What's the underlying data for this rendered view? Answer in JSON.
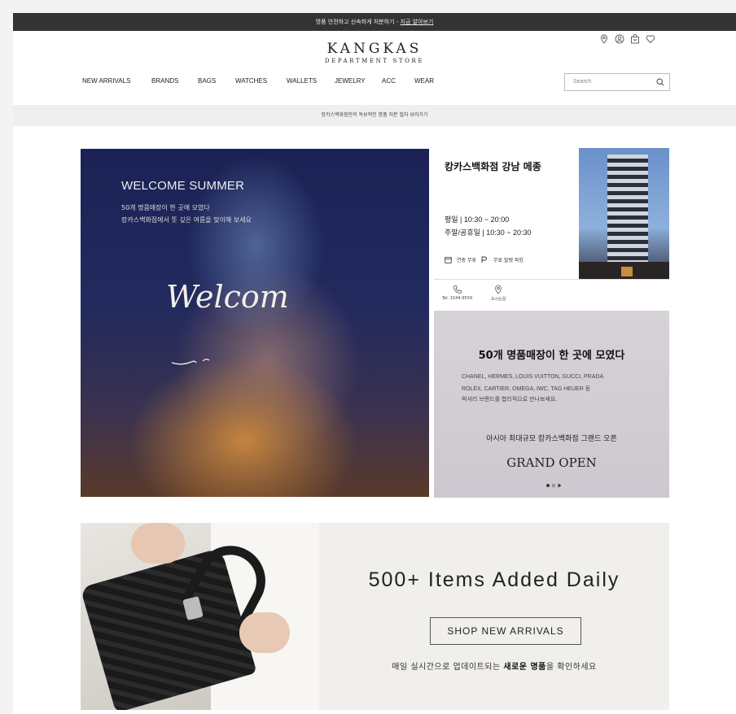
{
  "topbar": {
    "text": "명품 안전하고 신속하게 처분하기 - ",
    "link": "지금 알아보기"
  },
  "logo": {
    "name": "KANGKAS",
    "sub": "DEPARTMENT STORE"
  },
  "header_icons": [
    "location-icon",
    "user-icon",
    "shopping-bag-icon",
    "heart-icon"
  ],
  "nav": [
    "NEW ARRIVALS",
    "BRANDS",
    "BAGS",
    "WATCHES",
    "WALLETS",
    "JEWELRY",
    "ACC",
    "WEAR"
  ],
  "search": {
    "placeholder": "Search"
  },
  "subbar": {
    "text": "캉카스백화점만의 독보적인 명품 처분 절차 보러가기"
  },
  "hero": {
    "title": "WELCOME SUMMER",
    "line1": "50개 명품매장이 한 곳에 모였다",
    "line2": "캉카스백화점에서 뜻 깊은 여름을 맞이해 보세요",
    "script": "Welcom"
  },
  "store": {
    "title": "캉카스백화점 강남 메종",
    "weekday": "평일  | 10:30 ~ 20:00",
    "weekend": "주말/공휴일  | 10:30 ~ 20:30",
    "feature1": "연중 무휴",
    "feature2": "무료 발렛 파킹"
  },
  "contact": {
    "phone_label": "Tel. 1544-9559",
    "map_label": "오시는길"
  },
  "card": {
    "title": "50개 명품매장이 한 곳에 모였다",
    "brands1": "CHANEL, HERMES, LOUIS VUITTON, GUCCI, PRADA",
    "brands2": "ROLEX, CARTIER, OMEGA, IWC, TAG HEUER 등",
    "brands3": "럭셔리 브랜드를 합리적으로 만나보세요.",
    "sub": "아시아 최대규모 캉카스백화점 그랜드 오픈",
    "big": "GRAND OPEN"
  },
  "banner": {
    "title": "500+ Items Added Daily",
    "button": "SHOP NEW ARRIVALS",
    "note_pre": "매일 실시간으로 업데이트되는 ",
    "note_bold": "새로운 명품",
    "note_post": "을 확인하세요"
  },
  "colors": {
    "topbar": "#333333",
    "card": "#d3cfd5",
    "banner": "#f1efeb"
  }
}
